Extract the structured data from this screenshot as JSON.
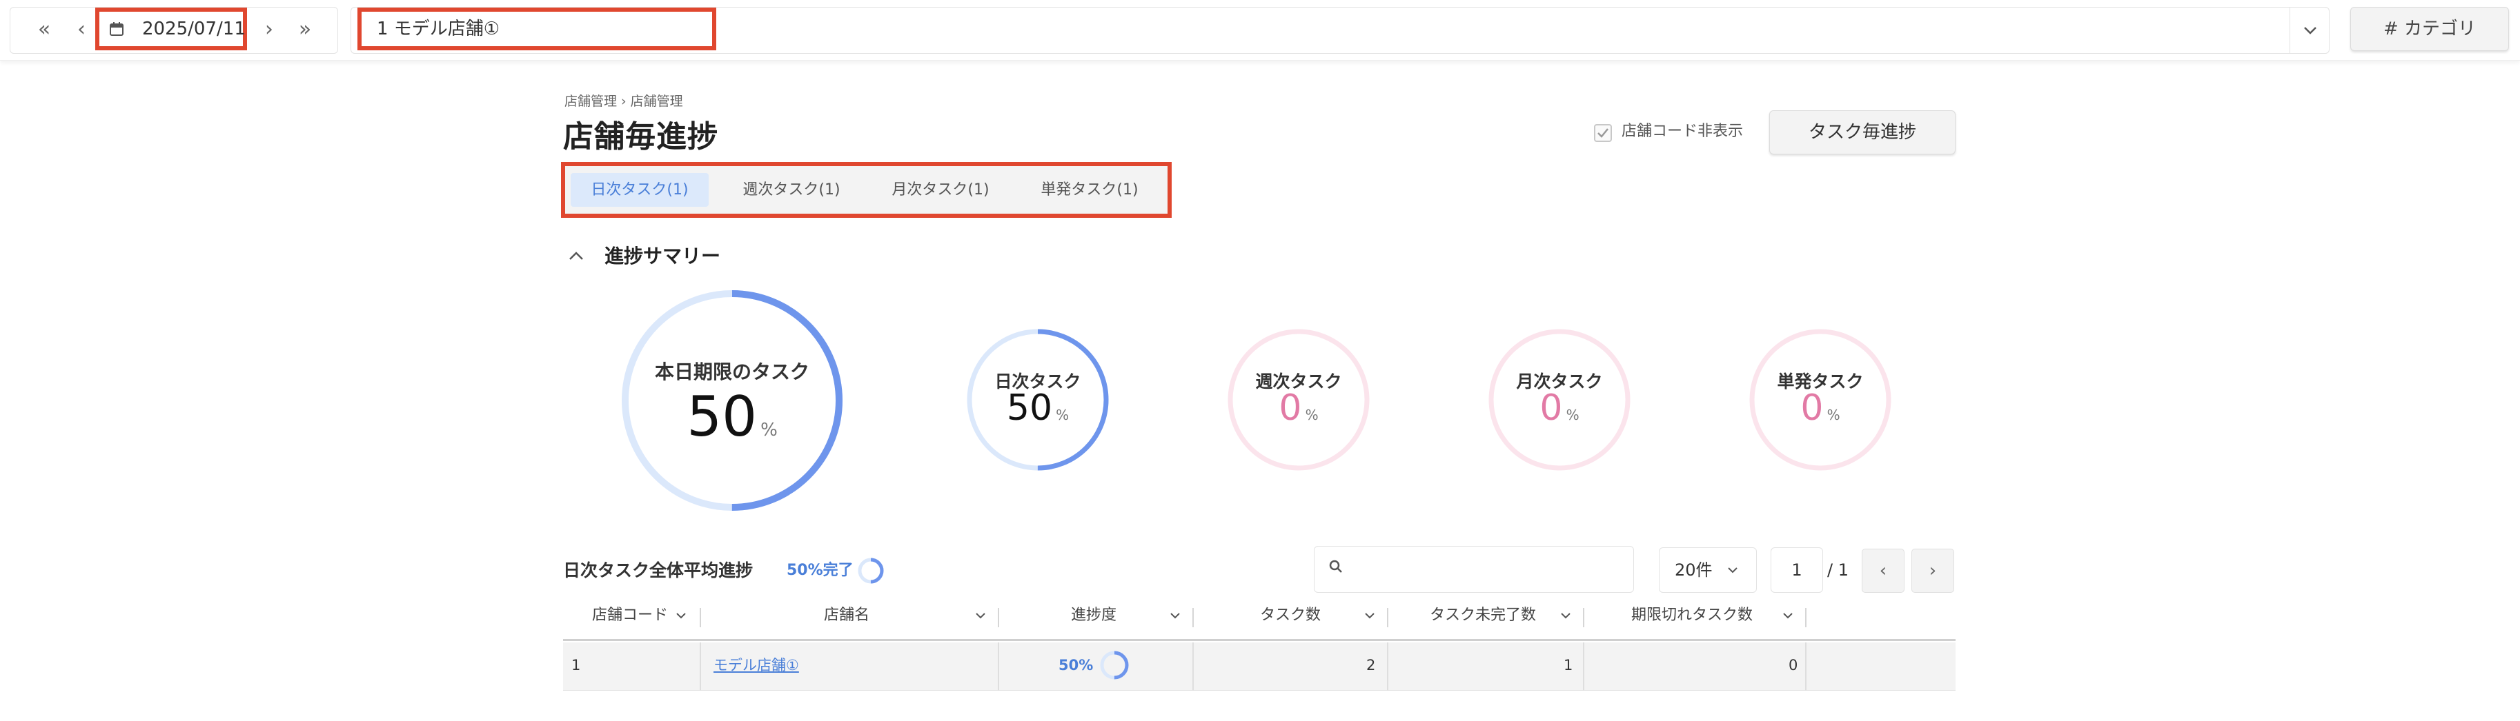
{
  "topbar": {
    "nav_first": "«",
    "nav_prev": "‹",
    "nav_next": "›",
    "nav_last": "»",
    "date": "2025/07/11",
    "store_selected": "1  モデル店舗①",
    "category_button": "# カテゴリ"
  },
  "header": {
    "breadcrumb": "店舗管理 › 店舗管理",
    "title": "店舗毎進捗",
    "hide_code_label": "店舗コード非表示",
    "task_progress_button": "タスク毎進捗"
  },
  "tabs": [
    {
      "label": "日次タスク(1)",
      "active": true
    },
    {
      "label": "週次タスク(1)",
      "active": false
    },
    {
      "label": "月次タスク(1)",
      "active": false
    },
    {
      "label": "単発タスク(1)",
      "active": false
    }
  ],
  "summary": {
    "heading": "進捗サマリー",
    "main": {
      "label": "本日期限のタスク",
      "value": 50,
      "value_text": "50",
      "unit": "%"
    },
    "gauges": [
      {
        "label": "日次タスク",
        "value": 50,
        "value_text": "50",
        "unit": "%"
      },
      {
        "label": "週次タスク",
        "value": 0,
        "value_text": "0",
        "unit": "%"
      },
      {
        "label": "月次タスク",
        "value": 0,
        "value_text": "0",
        "unit": "%"
      },
      {
        "label": "単発タスク",
        "value": 0,
        "value_text": "0",
        "unit": "%"
      }
    ],
    "colors": {
      "progress": "#6e95ec",
      "track_blue": "#dbe8fb",
      "track_pink": "#fbe4ec",
      "zero_text": "#e27aa5"
    }
  },
  "table_section": {
    "avg_label": "日次タスク全体平均進捗",
    "avg_percent_text": "50%完了",
    "avg_value": 50,
    "per_page": "20件",
    "page": "1",
    "page_total": "/ 1",
    "prev": "‹",
    "next": "›",
    "columns": [
      "店舗コード",
      "店舗名",
      "進捗度",
      "タスク数",
      "タスク未完了数",
      "期限切れタスク数"
    ],
    "rows": [
      {
        "code": "1",
        "name": "モデル店舗①",
        "progress_text": "50%",
        "progress": 50,
        "tasks": "2",
        "incomplete": "1",
        "expired": "0"
      }
    ]
  }
}
